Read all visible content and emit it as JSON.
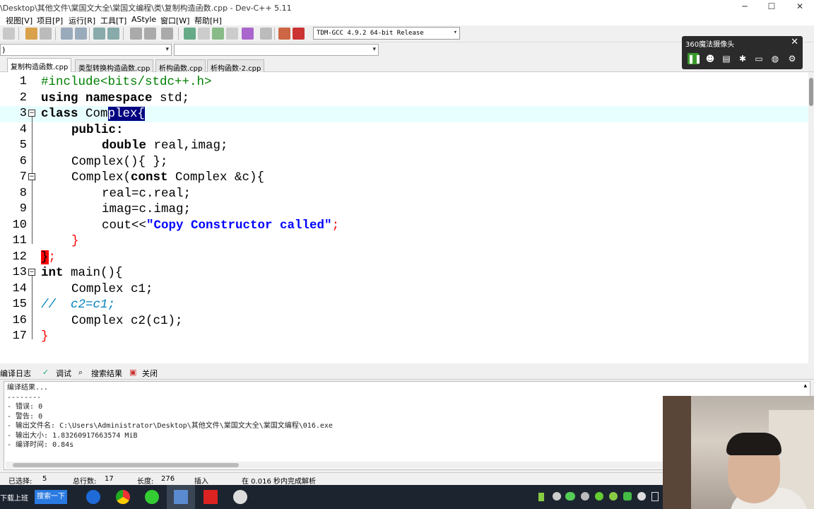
{
  "window": {
    "title": "\\Desktop\\其他文件\\棠国文大全\\棠国文编程\\类\\复制构造函数.cpp - Dev-C++ 5.11",
    "minimize": "─",
    "maximize": "☐",
    "close": "✕"
  },
  "menu": [
    "视图[V]",
    "项目[P]",
    "运行[R]",
    "工具[T]",
    "AStyle",
    "窗口[W]",
    "帮助[H]"
  ],
  "toolbar": {
    "compiler": "TDM-GCC 4.9.2 64-bit Release",
    "combo_left": ")"
  },
  "tabs": [
    "复制构造函数.cpp",
    "类型转换构造函数.cpp",
    "析构函数.cpp",
    "析构函数-2.cpp"
  ],
  "editor": {
    "lines": [
      {
        "n": "1"
      },
      {
        "n": "2"
      },
      {
        "n": "3"
      },
      {
        "n": "4"
      },
      {
        "n": "5"
      },
      {
        "n": "6"
      },
      {
        "n": "7"
      },
      {
        "n": "8"
      },
      {
        "n": "9"
      },
      {
        "n": "10"
      },
      {
        "n": "11"
      },
      {
        "n": "12"
      },
      {
        "n": "13"
      },
      {
        "n": "14"
      },
      {
        "n": "15"
      },
      {
        "n": "16"
      },
      {
        "n": "17"
      }
    ],
    "code": {
      "l1": "#include<bits/stdc++.h>",
      "l2_kw": "using namespace",
      "l2_rest": " std;",
      "l3_kw": "class",
      "l3_a": " Com",
      "l3_sel": "plex{",
      "l4": "public:",
      "l5_kw": "double",
      "l5_rest": " real,imag;",
      "l6": "Complex(){ };",
      "l7_name": "Complex(",
      "l7_kw": "const",
      "l7_rest": " Complex &c){",
      "l8": "real=c.real;",
      "l9": "imag=c.imag;",
      "l10_a": "cout<<",
      "l10_str": "\"Copy Constructor called\"",
      "l10_b": ";",
      "l11": "}",
      "l12_brace": "}",
      "l12_rest": ";",
      "l13_kw": "int",
      "l13_rest": " main(){",
      "l14": "Complex c1;",
      "l15": "//  c2=c1;",
      "l16": "Complex c2(c1);",
      "l17": "}"
    }
  },
  "cam360": {
    "title": "360魔法摄像头",
    "close": "✕"
  },
  "bottom_tabs": [
    "编译日志",
    "调试",
    "搜索结果",
    "关闭"
  ],
  "log": {
    "text": "编译结果...\n--------\n- 错误: 0\n- 警告: 0\n- 输出文件名: C:\\Users\\Administrator\\Desktop\\其他文件\\棠国文大全\\棠国文编程\\016.exe\n- 输出大小: 1.83260917663574 MiB\n- 编译时间: 0.84s"
  },
  "status": {
    "selected_label": "已选择:",
    "selected_value": "5",
    "lines_label": "总行数:",
    "lines_value": "17",
    "length_label": "长度:",
    "length_value": "276",
    "mode": "插入",
    "parse": "在 0.016 秒内完成解析"
  },
  "taskbar": {
    "left_text": "下载上班",
    "search_button": "搜索一下"
  }
}
